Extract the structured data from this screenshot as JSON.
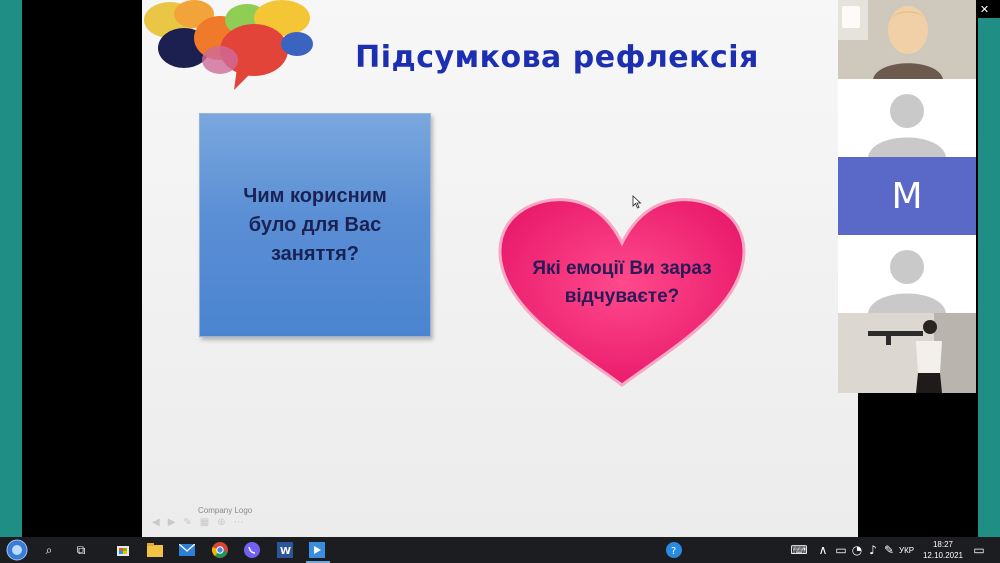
{
  "slide": {
    "title": "Підсумкова рефлексія",
    "blue_box_text": "Чим корисним було для Вас заняття?",
    "heart_text": "Які емоції Ви зараз відчуваєте?",
    "footer_logo": "Company Logo"
  },
  "participants": {
    "tile_m_letter": "M"
  },
  "taskbar": {
    "time": "18:27",
    "date": "12.10.2021",
    "language": "УКР"
  },
  "colors": {
    "title": "#1c2fb0",
    "blue_box": "#5b8fd5",
    "heart": "#f0206e",
    "avatar_m": "#5a68c8",
    "side_edge": "#1f8f86"
  }
}
